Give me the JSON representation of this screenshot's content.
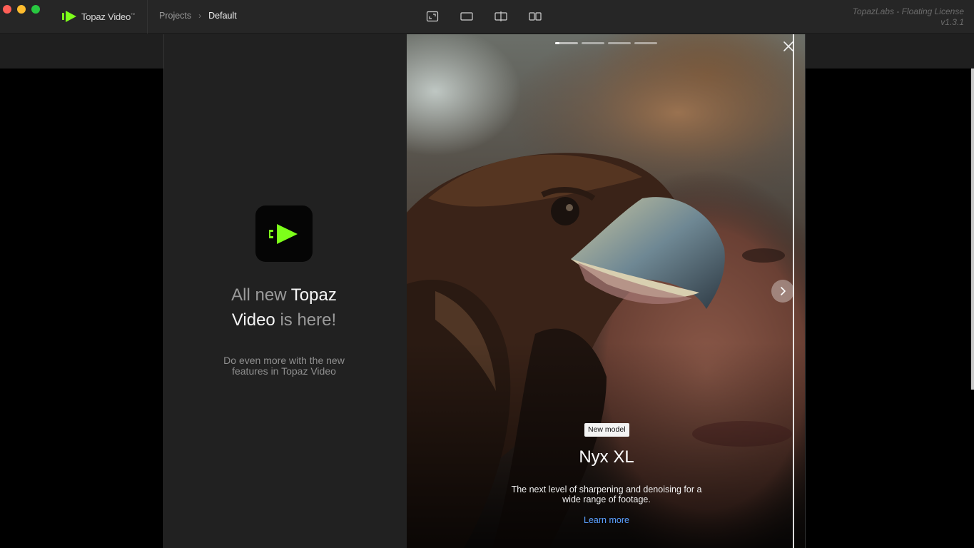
{
  "titlebar": {
    "app_name": "Topaz Video",
    "app_mark": "™",
    "breadcrumb": {
      "projects": "Projects",
      "separator": "›",
      "current": "Default"
    },
    "view_icons": [
      "crop-view-icon",
      "single-view-icon",
      "split-view-icon",
      "side-by-side-view-icon"
    ],
    "license": {
      "line1": "TopazLabs - Floating License",
      "line2": "v1.3.1"
    }
  },
  "modal": {
    "left": {
      "headline": {
        "part1": "All new ",
        "part2": "Topaz",
        "part3": "Video",
        "part4": " is here!"
      },
      "subtitle": "Do even more with the new features in Topaz Video"
    },
    "slide": {
      "badge": "New model",
      "title": "Nyx XL",
      "description": "The next level of sharpening and denoising for a wide range of footage.",
      "link": "Learn more",
      "progress": {
        "total": 4,
        "current": 1,
        "current_fill": 0.2
      }
    }
  },
  "colors": {
    "brand_green": "#7dff1a",
    "link_blue": "#5aa0ff",
    "titlebar_bg": "#262626",
    "modal_bg": "#212121"
  }
}
